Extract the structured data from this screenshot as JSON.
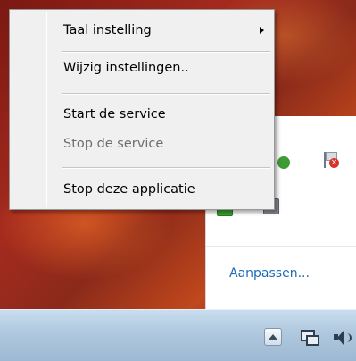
{
  "context_menu": {
    "items": [
      {
        "label": "Taal instelling",
        "has_submenu": true,
        "enabled": true
      },
      {
        "label": "Wijzig instellingen..",
        "enabled": true
      },
      {
        "label": "Start de service",
        "enabled": true
      },
      {
        "label": "Stop de service",
        "enabled": false
      },
      {
        "label": "Stop deze applicatie",
        "enabled": true
      }
    ]
  },
  "tray_overflow": {
    "customize_link": "Aanpassen...",
    "icons": [
      "green-check-icon",
      "flag-error-icon",
      "green-app-icon",
      "gray-app-icon"
    ]
  },
  "taskbar": {
    "icons": [
      "show-hidden-icons-button",
      "network-icon",
      "volume-icon"
    ]
  },
  "colors": {
    "link": "#1f6bb6",
    "menu_bg": "#f0f0f0",
    "disabled_text": "#6d6d6d",
    "taskbar": "#afc8de"
  }
}
